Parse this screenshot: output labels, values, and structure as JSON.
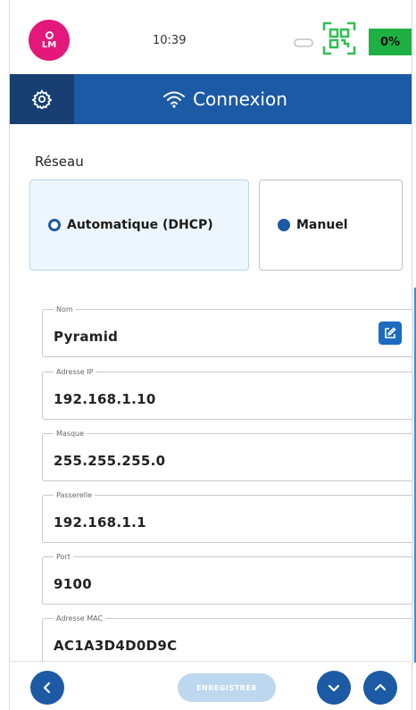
{
  "status_bar": {
    "user_initials": "LM",
    "time": "10:39",
    "battery_text": "0%"
  },
  "header": {
    "settings_icon": "gear-icon",
    "wifi_icon": "wifi-icon",
    "title": "Connexion"
  },
  "network": {
    "section_label": "Réseau",
    "modes": [
      {
        "label": "Automatique (DHCP)",
        "selected": true
      },
      {
        "label": "Manuel",
        "selected": false
      }
    ]
  },
  "fields": [
    {
      "label": "Nom",
      "value": "Pyramid",
      "editable": true
    },
    {
      "label": "Adresse IP",
      "value": "192.168.1.10"
    },
    {
      "label": "Masque",
      "value": "255.255.255.0"
    },
    {
      "label": "Passerelle",
      "value": "192.168.1.1"
    },
    {
      "label": "Port",
      "value": "9100"
    },
    {
      "label": "Adresse MAC",
      "value": "AC1A3D4D0D9C"
    }
  ],
  "footer": {
    "back_icon": "chevron-left-icon",
    "save_label": "ENREGISTRER",
    "down_icon": "chevron-down-icon",
    "up_icon": "chevron-up-icon"
  },
  "colors": {
    "primary": "#1c5aa5",
    "primary_dark": "#173f72",
    "avatar": "#e4187a",
    "battery": "#1fb043",
    "qr": "#2fbf4f"
  }
}
